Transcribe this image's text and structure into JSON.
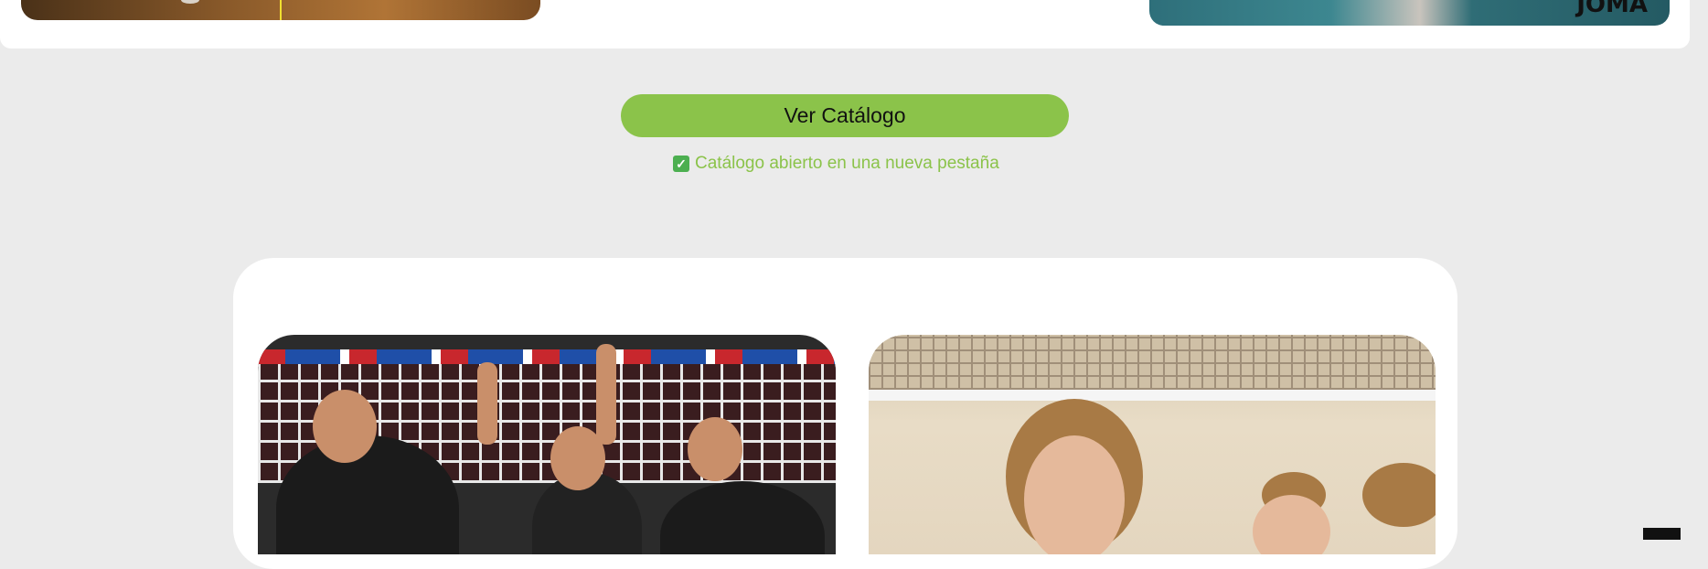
{
  "top_right_logo": "JOMA",
  "catalog": {
    "button_label": "Ver Catálogo",
    "checkbox_glyph": "✓",
    "note": "Catálogo abierto en una nueva pestaña"
  },
  "colors": {
    "accent": "#8bc34a",
    "page_bg": "#ebebeb",
    "card_bg": "#ffffff"
  }
}
